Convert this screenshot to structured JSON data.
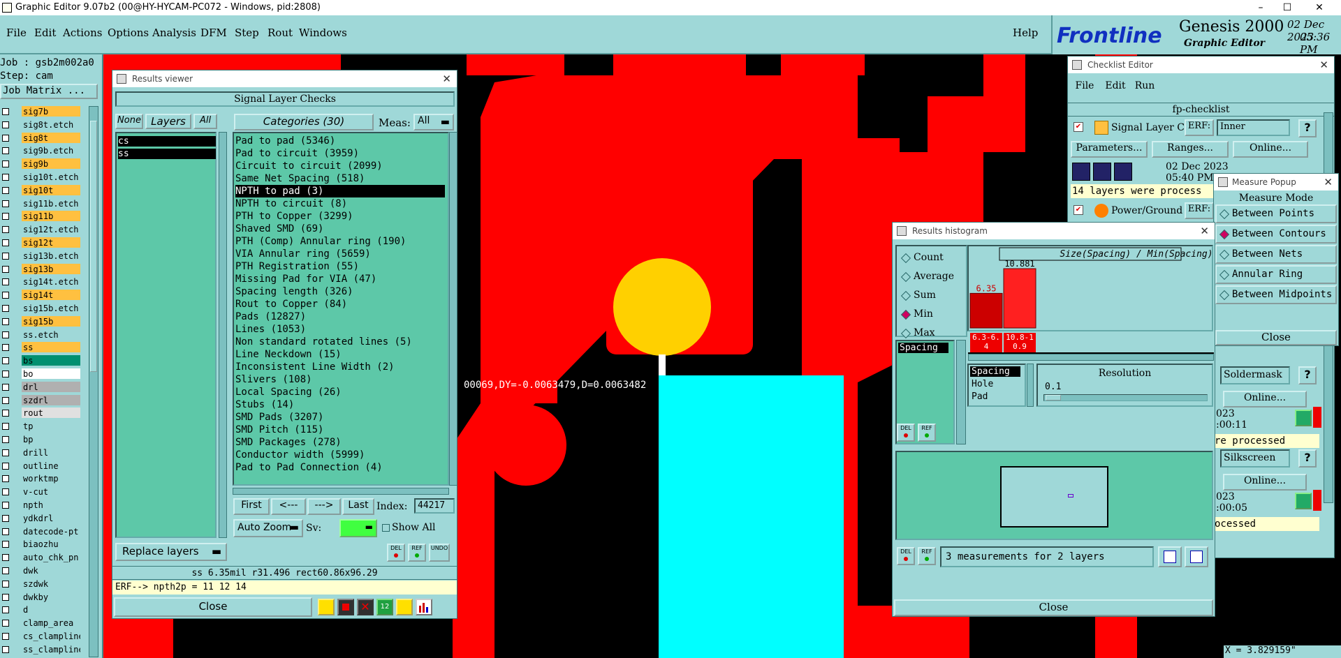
{
  "window": {
    "title": "Graphic Editor 9.07b2 (00@HY-HYCAM-PC072 - Windows, pid:2808)",
    "minimize": "–",
    "maximize": "☐",
    "close": "✕"
  },
  "menu": {
    "items": [
      "File",
      "Edit",
      "Actions",
      "Options",
      "Analysis",
      "DFM",
      "Step",
      "Rout",
      "Windows"
    ],
    "help": "Help"
  },
  "logo": {
    "brand": "Frontline",
    "product": "Genesis 2000",
    "subtitle": "Graphic Editor",
    "date": "02 Dec 2023",
    "time": "05:36 PM"
  },
  "job": {
    "job": "Job : gsb2m002a0",
    "step": "Step: cam",
    "matrix": "Job Matrix ..."
  },
  "layers": [
    {
      "name": "sig7b",
      "color": "#ffc040"
    },
    {
      "name": "sig8t.etch",
      "color": "#9fd8d8"
    },
    {
      "name": "sig8t",
      "color": "#ffc040"
    },
    {
      "name": "sig9b.etch",
      "color": "#9fd8d8"
    },
    {
      "name": "sig9b",
      "color": "#ffc040"
    },
    {
      "name": "sig10t.etch",
      "color": "#9fd8d8"
    },
    {
      "name": "sig10t",
      "color": "#ffc040"
    },
    {
      "name": "sig11b.etch",
      "color": "#9fd8d8"
    },
    {
      "name": "sig11b",
      "color": "#ffc040"
    },
    {
      "name": "sig12t.etch",
      "color": "#9fd8d8"
    },
    {
      "name": "sig12t",
      "color": "#ffc040"
    },
    {
      "name": "sig13b.etch",
      "color": "#9fd8d8"
    },
    {
      "name": "sig13b",
      "color": "#ffc040"
    },
    {
      "name": "sig14t.etch",
      "color": "#9fd8d8"
    },
    {
      "name": "sig14t",
      "color": "#ffc040"
    },
    {
      "name": "sig15b.etch",
      "color": "#9fd8d8"
    },
    {
      "name": "sig15b",
      "color": "#ffc040"
    },
    {
      "name": "ss.etch",
      "color": "#9fd8d8"
    },
    {
      "name": "ss",
      "color": "#ffc040"
    },
    {
      "name": "bs",
      "color": "#009070"
    },
    {
      "name": "bo",
      "color": "#ffffff"
    },
    {
      "name": "drl",
      "color": "#b0b0b0"
    },
    {
      "name": "szdrl",
      "color": "#b0b0b0"
    },
    {
      "name": "rout",
      "color": "#e0e0e0"
    },
    {
      "name": "tp",
      "color": "#9fd8d8"
    },
    {
      "name": "bp",
      "color": "#9fd8d8"
    },
    {
      "name": "drill",
      "color": "#9fd8d8"
    },
    {
      "name": "outline",
      "color": "#9fd8d8"
    },
    {
      "name": "worktmp",
      "color": "#9fd8d8"
    },
    {
      "name": "v-cut",
      "color": "#9fd8d8"
    },
    {
      "name": "npth",
      "color": "#9fd8d8"
    },
    {
      "name": "ydkdrl",
      "color": "#9fd8d8"
    },
    {
      "name": "datecode-pt",
      "color": "#9fd8d8"
    },
    {
      "name": "biaozhu",
      "color": "#9fd8d8"
    },
    {
      "name": "auto_chk_pn",
      "color": "#9fd8d8"
    },
    {
      "name": "dwk",
      "color": "#9fd8d8"
    },
    {
      "name": "szdwk",
      "color": "#9fd8d8"
    },
    {
      "name": "dwkby",
      "color": "#9fd8d8"
    },
    {
      "name": "d",
      "color": "#9fd8d8"
    },
    {
      "name": "clamp_area",
      "color": "#9fd8d8"
    },
    {
      "name": "cs_clampline",
      "color": "#9fd8d8"
    },
    {
      "name": "ss_clampline",
      "color": "#9fd8d8"
    }
  ],
  "results": {
    "title": "Results viewer",
    "header": "Signal Layer Checks",
    "none": "None",
    "layers": "Layers",
    "all": "All",
    "layer_items": [
      "cs",
      "ss"
    ],
    "categories": "Categories (30)",
    "meas_label": "Meas:",
    "meas_value": "All",
    "items": [
      "Pad to pad (5346)",
      "Pad to circuit (3959)",
      "Circuit to circuit (2099)",
      "Same Net Spacing (518)",
      "NPTH to pad (3)",
      "NPTH to circuit (8)",
      "PTH to Copper (3299)",
      "Shaved SMD (69)",
      "PTH (Comp) Annular ring (190)",
      "VIA Annular ring (5659)",
      "PTH Registration (55)",
      "Missing Pad for VIA (47)",
      "Spacing length (326)",
      "Rout to Copper (84)",
      "Pads (12827)",
      "Lines (1053)",
      "Non standard rotated lines (5)",
      "Line Neckdown (15)",
      "Inconsistent Line Width (2)",
      "Slivers (108)",
      "Local Spacing (26)",
      "Stubs (14)",
      "SMD Pads (3207)",
      "SMD Pitch (115)",
      "SMD Packages (278)",
      "Conductor width (5999)",
      "Pad to Pad Connection (4)"
    ],
    "first": "First",
    "prev": "<---",
    "next": "--->",
    "last": "Last",
    "index_label": "Index:",
    "index_value": "44217",
    "auto_zoom": "Auto Zoom",
    "sv_label": "Sv:",
    "show_all": "Show All",
    "replace_layers": "Replace layers",
    "del": "DEL",
    "ref": "REF",
    "undo": "UNDO",
    "status": "ss 6.35mil  r31.496  rect60.86x96.29",
    "erf": "ERF--> npth2p = 11 12 14",
    "close": "Close"
  },
  "canvas": {
    "readout": "00069,DY=-0.0063479,D=0.0063482"
  },
  "checklist": {
    "title": "Checklist Editor",
    "menu": [
      "File",
      "Edit",
      "Run"
    ],
    "name": "fp-checklist",
    "row1_label": "Signal Layer Ch",
    "erf": "ERF:",
    "row1_value": "Inner",
    "parameters": "Parameters...",
    "ranges": "Ranges...",
    "online": "Online...",
    "date": "02 Dec 2023",
    "time": "05:40 PM -",
    "processed": "14 layers were process",
    "row2_label": "Power/Ground C",
    "soldermask": "Soldermask",
    "online2": "Online...",
    "time2": ":00:11",
    "processed2": "re processed",
    "silkscreen": "Silkscreen",
    "online3": "Online...",
    "time3": ":00:05",
    "processed3": "ocessed",
    "yr": "023",
    "help": "?"
  },
  "measure": {
    "title": "Measure Popup",
    "mode": "Measure Mode",
    "options": [
      "Between Points",
      "Between Contours",
      "Between Nets",
      "Annular Ring",
      "Between Midpoints"
    ],
    "selected": 1,
    "close": "Close",
    "coord": "X = 3.829159\""
  },
  "histogram": {
    "title": "Results histogram",
    "stats": [
      "Count",
      "Average",
      "Sum",
      "Min",
      "Max"
    ],
    "selected": 3,
    "list_item": "Spacing",
    "chart_title": "Size(Spacing) / Min(Spacing)",
    "sublist": [
      "Spacing",
      "Hole",
      "Pad"
    ],
    "resolution_label": "Resolution",
    "resolution_value": "0.1",
    "summary": "3 measurements for 2 layers",
    "close": "Close",
    "del": "DEL",
    "ref": "REF"
  },
  "chart_data": {
    "type": "bar",
    "categories": [
      "6.3-6.4",
      "10.8-10.9"
    ],
    "values": [
      6.35,
      10.881
    ],
    "title": "Size(Spacing) / Min(Spacing)",
    "xlabel": "",
    "ylabel": ""
  }
}
